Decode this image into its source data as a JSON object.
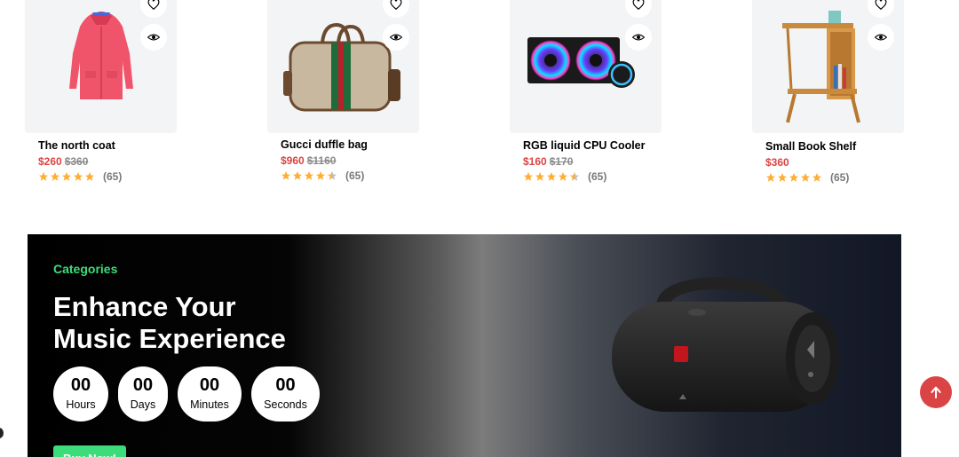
{
  "products": [
    {
      "name": "The north coat",
      "price": "$260",
      "old_price": "$360",
      "rating": 5,
      "reviews": "(65)"
    },
    {
      "name": "Gucci duffle bag",
      "price": "$960",
      "old_price": "$1160",
      "rating": 4.5,
      "reviews": "(65)"
    },
    {
      "name": "RGB liquid CPU Cooler",
      "price": "$160",
      "old_price": "$170",
      "rating": 4.5,
      "reviews": "(65)"
    },
    {
      "name": "Small Book Shelf",
      "price": "$360",
      "old_price": "",
      "rating": 5,
      "reviews": "(65)"
    }
  ],
  "banner": {
    "category": "Categories",
    "title_line1": "Enhance Your",
    "title_line2": "Music Experience",
    "timer": [
      {
        "value": "00",
        "label": "Hours"
      },
      {
        "value": "00",
        "label": "Days"
      },
      {
        "value": "00",
        "label": "Minutes"
      },
      {
        "value": "00",
        "label": "Seconds"
      }
    ],
    "button_label": "Buy Now!"
  },
  "colors": {
    "accent": "#db4444",
    "green": "#00ff66",
    "star": "#ffad33"
  },
  "icons": {
    "wishlist": "heart-icon",
    "quick_view": "eye-icon",
    "scroll_top": "arrow-up-icon"
  }
}
